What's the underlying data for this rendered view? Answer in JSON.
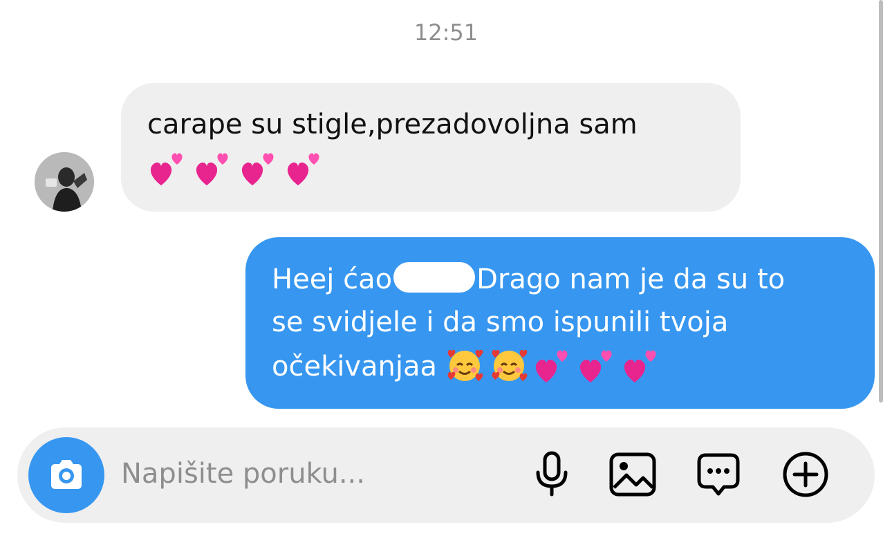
{
  "thread": {
    "timestamp": "12:51"
  },
  "messages": [
    {
      "direction": "incoming",
      "text": "carape su stigle,prezadovoljna sam",
      "emojis": [
        "two-hearts",
        "two-hearts",
        "two-hearts",
        "two-hearts"
      ]
    },
    {
      "direction": "outgoing",
      "line1_before": "Heej ćao",
      "line1_after": "Drago nam je da su to",
      "line2": "se svidjele i da smo ispunili tvoja",
      "line3": "očekivanjaa",
      "emojis": [
        "smiling-face-with-hearts",
        "smiling-face-with-hearts",
        "two-hearts",
        "two-hearts",
        "two-hearts"
      ]
    }
  ],
  "composer": {
    "placeholder": "Napišite poruku...",
    "icons": [
      "camera-icon",
      "microphone-icon",
      "gallery-icon",
      "sticker-message-icon",
      "add-icon"
    ]
  },
  "colors": {
    "outgoing_bubble": "#3797f0",
    "incoming_bubble": "#efefef",
    "composer_bg": "#efefef",
    "timestamp": "#8e8e8e"
  }
}
